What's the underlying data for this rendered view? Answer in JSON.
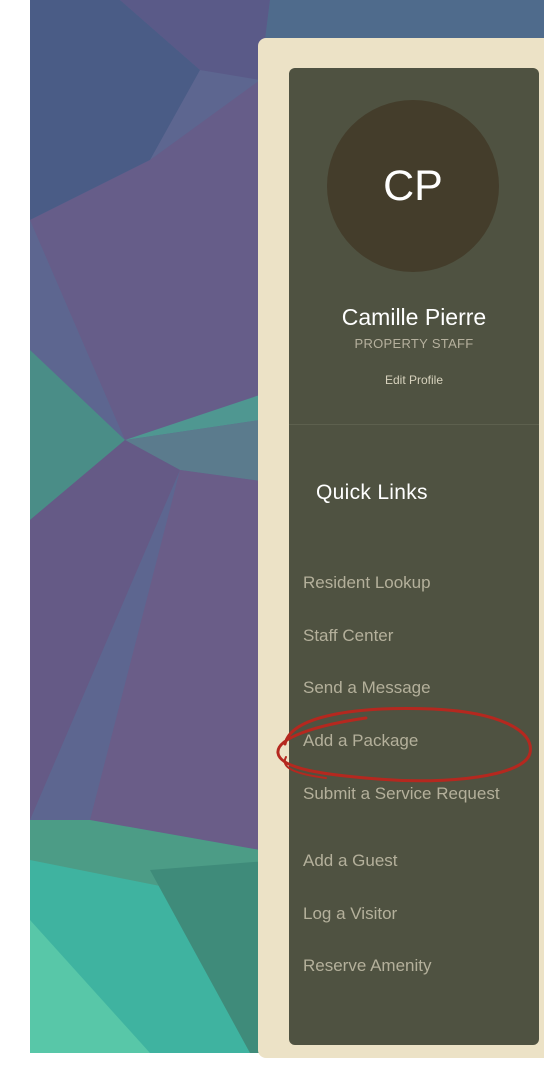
{
  "profile": {
    "initials": "CP",
    "name": "Camille Pierre",
    "role": "PROPERTY STAFF",
    "edit_label": "Edit Profile"
  },
  "quick_links": {
    "title": "Quick Links",
    "items": [
      {
        "label": "Resident Lookup"
      },
      {
        "label": "Staff Center"
      },
      {
        "label": "Send a Message"
      },
      {
        "label": "Add a Package"
      },
      {
        "label": "Submit a Service Request"
      },
      {
        "label": "Add a Guest"
      },
      {
        "label": "Log a Visitor"
      },
      {
        "label": "Reserve Amenity"
      }
    ]
  },
  "colors": {
    "panel": "#4f5241",
    "card": "#ece2c6",
    "avatar": "#443d2b",
    "link_text": "#b4b09b",
    "annotation": "#b5281f"
  }
}
